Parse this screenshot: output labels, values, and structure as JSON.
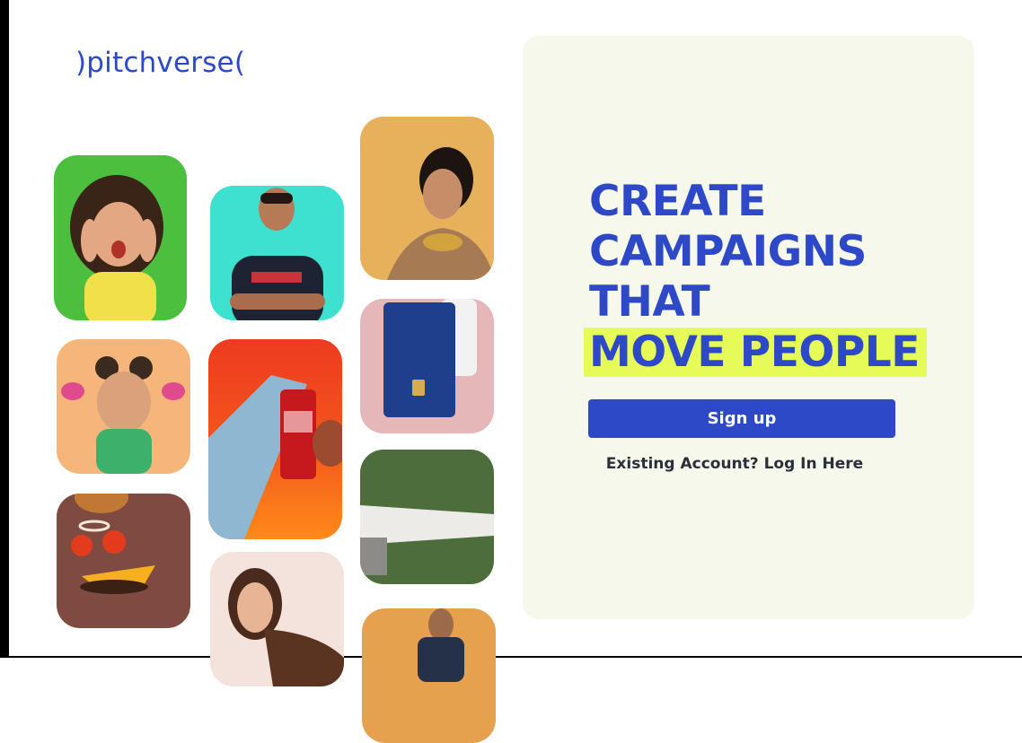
{
  "brand": {
    "logo_text": ")pitchverse("
  },
  "hero": {
    "headline_lines": [
      "CREATE",
      "CAMPAIGNS",
      "THAT"
    ],
    "headline_highlight": "MOVE PEOPLE"
  },
  "actions": {
    "signup_label": "Sign up",
    "login_label": "Existing Account? Log In Here"
  },
  "colors": {
    "brand_blue": "#2d49c8",
    "highlight_yellow": "#e6fb57",
    "panel_bg": "#f7f8ec"
  },
  "gallery": {
    "tiles": [
      {
        "subject": "surprised-woman",
        "bg": "#4cbf3f"
      },
      {
        "subject": "cricketer",
        "bg": "#3ee0d0"
      },
      {
        "subject": "woman-jewelry",
        "bg": "#e7b15c"
      },
      {
        "subject": "girl-cupcakes",
        "bg": "#f6b67a"
      },
      {
        "subject": "cola-can",
        "bg": "#f2541c"
      },
      {
        "subject": "credit-card",
        "bg": "#e6b7b9"
      },
      {
        "subject": "burger",
        "bg": "#7f4a40"
      },
      {
        "subject": "airplane",
        "bg": "#4d6e3c"
      },
      {
        "subject": "woman-hair",
        "bg": "#f4e3dc"
      },
      {
        "subject": "businessman",
        "bg": "#e6a14f"
      }
    ]
  }
}
